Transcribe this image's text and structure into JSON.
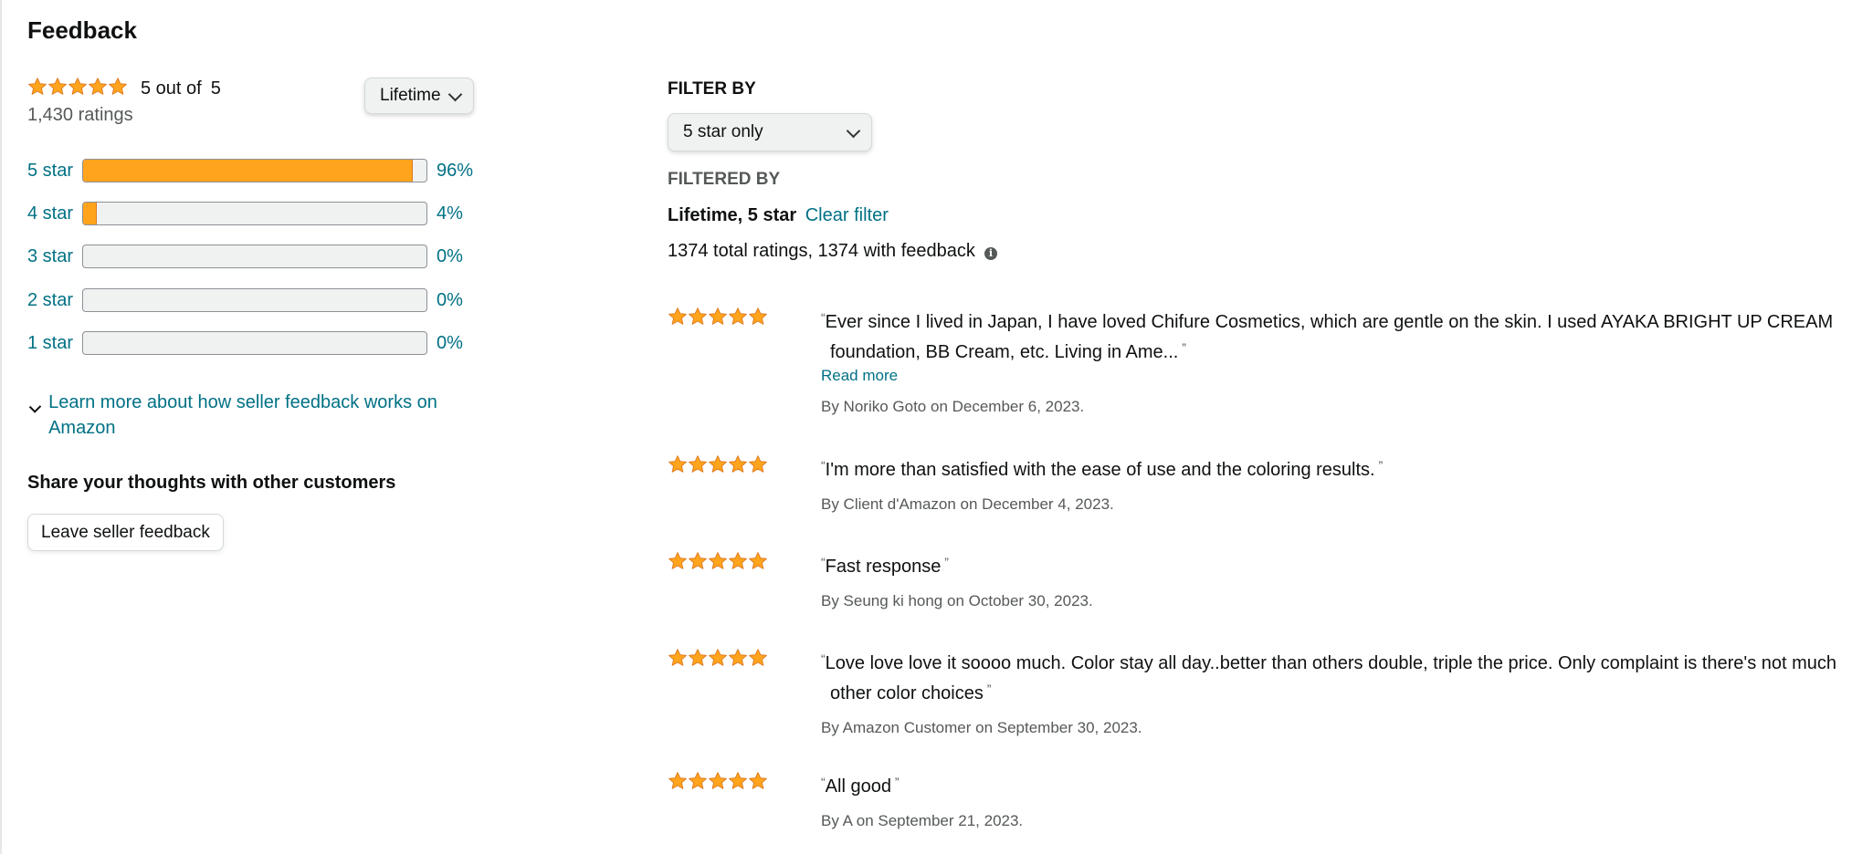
{
  "page": {
    "title": "Feedback"
  },
  "summary": {
    "out_of_a": "5 out of",
    "out_of_b": "5",
    "ratings": "1,430 ratings",
    "period_selected": "Lifetime",
    "star_rating": 5
  },
  "histogram": [
    {
      "label": "5 star",
      "percent_text": "96%",
      "fill": 0.96
    },
    {
      "label": "4 star",
      "percent_text": "4%",
      "fill": 0.04
    },
    {
      "label": "3 star",
      "percent_text": "0%",
      "fill": 0
    },
    {
      "label": "2 star",
      "percent_text": "0%",
      "fill": 0
    },
    {
      "label": "1 star",
      "percent_text": "0%",
      "fill": 0
    }
  ],
  "learn_more": "Learn more about how seller feedback works on Amazon",
  "share": {
    "heading": "Share your thoughts with other customers",
    "button": "Leave seller feedback"
  },
  "filters": {
    "filter_by_label": "FILTER BY",
    "filter_selected": "5 star only",
    "filtered_by_label": "FILTERED BY",
    "active": "Lifetime, 5 star",
    "clear": "Clear filter",
    "totals": "1374 total ratings, 1374 with feedback"
  },
  "reviews": [
    {
      "text": "Ever since I lived in Japan, I have loved Chifure Cosmetics, which are gentle on the skin. I used AYAKA BRIGHT UP CREAM foundation, BB Cream, etc. Living in Ame...",
      "read_more": "Read more",
      "byline": "By Noriko Goto on December 6, 2023.",
      "stars": 5
    },
    {
      "text": "I'm more than satisfied with the ease of use and the coloring results.",
      "byline": "By Client d'Amazon on December 4, 2023.",
      "stars": 5
    },
    {
      "text": "Fast response",
      "byline": "By Seung ki hong on October 30, 2023.",
      "stars": 5
    },
    {
      "text": "Love love love it soooo much. Color stay all day..better than others double, triple the price. Only complaint is there's not much other color choices",
      "byline": "By Amazon Customer on September 30, 2023.",
      "stars": 5
    },
    {
      "text": "All good",
      "byline": "By A on September 21, 2023.",
      "stars": 5
    }
  ],
  "colors": {
    "star": "#ffa41c",
    "star_outline": "#de7921",
    "link": "#007185",
    "text": "#0f1111",
    "muted": "#565959"
  },
  "icons": [
    "star-icon",
    "chevron-down-icon",
    "info-icon"
  ]
}
